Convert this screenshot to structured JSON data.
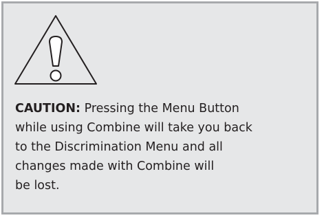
{
  "caution": {
    "icon": "warning-triangle-exclamation-icon",
    "label": "CAUTION:",
    "lines": [
      "Pressing the Menu Button",
      "while using Combine will take you back",
      "to the Discrimination Menu and all",
      "changes made with Combine will",
      "be lost."
    ]
  },
  "colors": {
    "box_background": "#e6e7e8",
    "box_border": "#a7a9ac",
    "text": "#231f20"
  }
}
